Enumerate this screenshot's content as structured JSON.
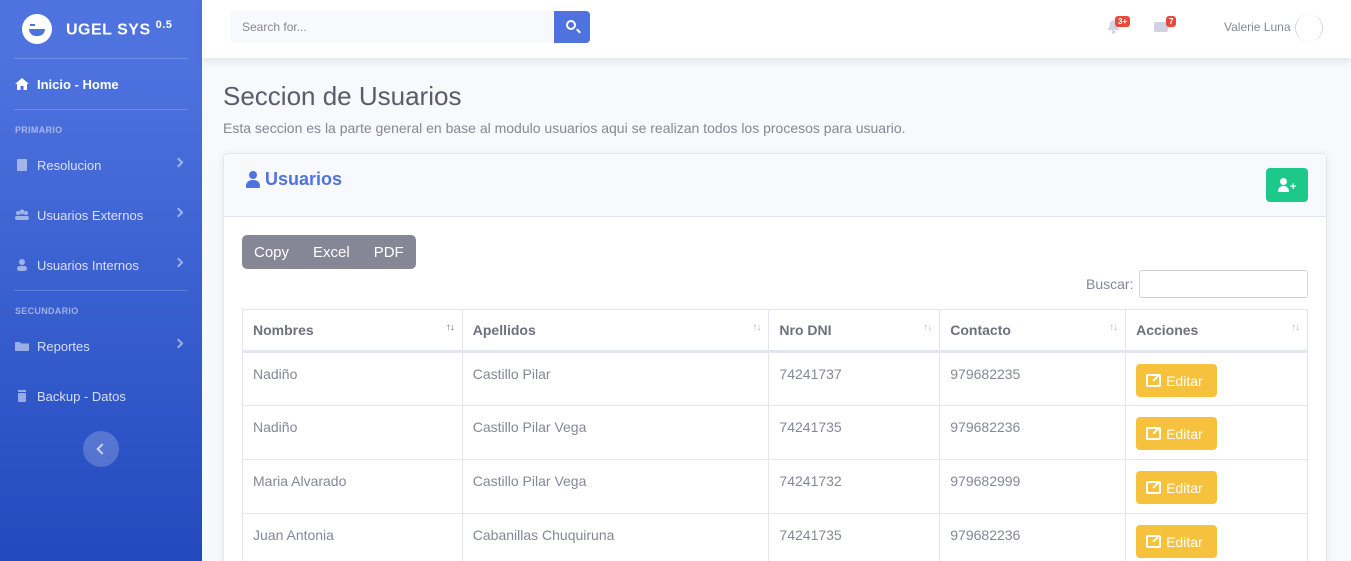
{
  "sidebar": {
    "brand": "UGEL SYS",
    "brand_version": "0.5",
    "home": "Inicio - Home",
    "heading_primary": "PRIMARIO",
    "items_primary": [
      "Resolucion",
      "Usuarios Externos",
      "Usuarios Internos"
    ],
    "heading_secondary": "SECUNDARIO",
    "items_secondary": [
      "Reportes",
      "Backup - Datos"
    ]
  },
  "topbar": {
    "search_placeholder": "Search for...",
    "alerts_badge": "3+",
    "messages_badge": "7",
    "user_name": "Valerie Luna"
  },
  "main": {
    "title": "Seccion de Usuarios",
    "description": "Esta seccion es la parte general en base al modulo usuarios aqui se realizan todos los procesos para usuario.",
    "card_title": "Usuarios",
    "export_buttons": [
      "Copy",
      "Excel",
      "PDF"
    ],
    "search_label": "Buscar:",
    "columns": [
      "Nombres",
      "Apellidos",
      "Nro DNI",
      "Contacto",
      "Acciones"
    ],
    "rows": [
      {
        "nombres": "Nadiño",
        "apellidos": "Castillo Pilar",
        "dni": "74241737",
        "contacto": "979682235"
      },
      {
        "nombres": "Nadiño",
        "apellidos": "Castillo Pilar Vega",
        "dni": "74241735",
        "contacto": "979682236"
      },
      {
        "nombres": "Maria Alvarado",
        "apellidos": "Castillo Pilar Vega",
        "dni": "74241732",
        "contacto": "979682999"
      },
      {
        "nombres": "Juan Antonia",
        "apellidos": "Cabanillas Chuquiruna",
        "dni": "74241735",
        "contacto": "979682236"
      }
    ],
    "edit_label": "Editar"
  },
  "colors": {
    "primary": "#4e73df",
    "success": "#1cc88a",
    "warning": "#f6c23e",
    "danger": "#e74a3b",
    "secondary": "#858796"
  }
}
